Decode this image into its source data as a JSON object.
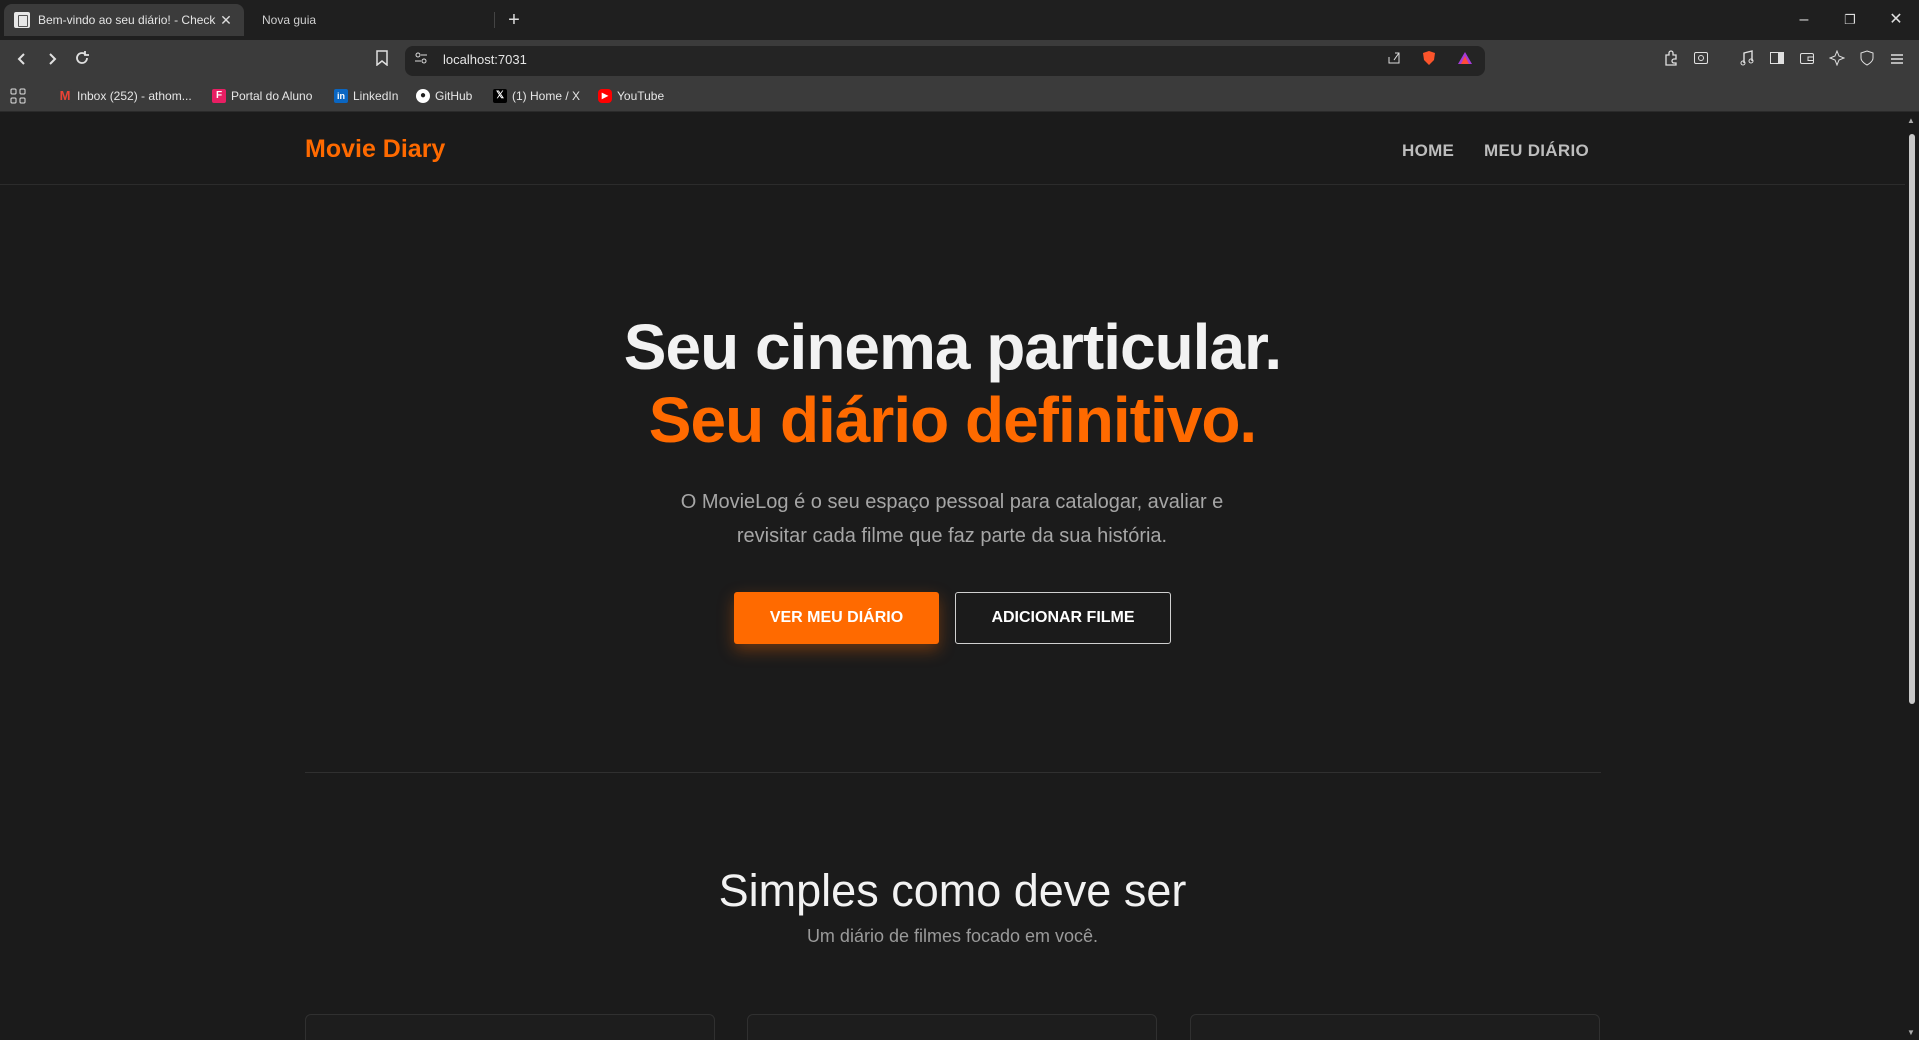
{
  "browser": {
    "tabs": [
      {
        "title": "Bem-vindo ao seu diário! - Check",
        "active": true
      },
      {
        "title": "Nova guia",
        "active": false
      }
    ],
    "new_tab": "+",
    "window_controls": {
      "minimize": "–",
      "restore": "❐",
      "close": "✕"
    },
    "url": "localhost:7031",
    "bookmarks": [
      {
        "label": "Inbox (252) - athom...",
        "icon": "gmail-icon",
        "color": "#ea4335"
      },
      {
        "label": "Portal do Aluno",
        "icon": "portal-icon",
        "color": "#e91e63"
      },
      {
        "label": "LinkedIn",
        "icon": "linkedin-icon",
        "color": "#0a66c2"
      },
      {
        "label": "GitHub",
        "icon": "github-icon",
        "color": "#ffffff"
      },
      {
        "label": "(1) Home / X",
        "icon": "x-icon",
        "color": "#000000"
      },
      {
        "label": "YouTube",
        "icon": "youtube-icon",
        "color": "#ff0000"
      }
    ]
  },
  "page": {
    "brand": "Movie Diary",
    "nav": [
      {
        "label": "HOME"
      },
      {
        "label": "MEU DIÁRIO"
      }
    ],
    "hero": {
      "line1": "Seu cinema particular.",
      "line2": "Seu diário definitivo.",
      "subtitle": "O MovieLog é o seu espaço pessoal para catalogar, avaliar e revisitar cada filme que faz parte da sua história.",
      "primary_button": "VER MEU DIÁRIO",
      "secondary_button": "ADICIONAR FILME"
    },
    "features": {
      "title": "Simples como deve ser",
      "subtitle": "Um diário de filmes focado em você."
    }
  },
  "colors": {
    "accent": "#ff6a00",
    "background": "#1b1b1b"
  }
}
